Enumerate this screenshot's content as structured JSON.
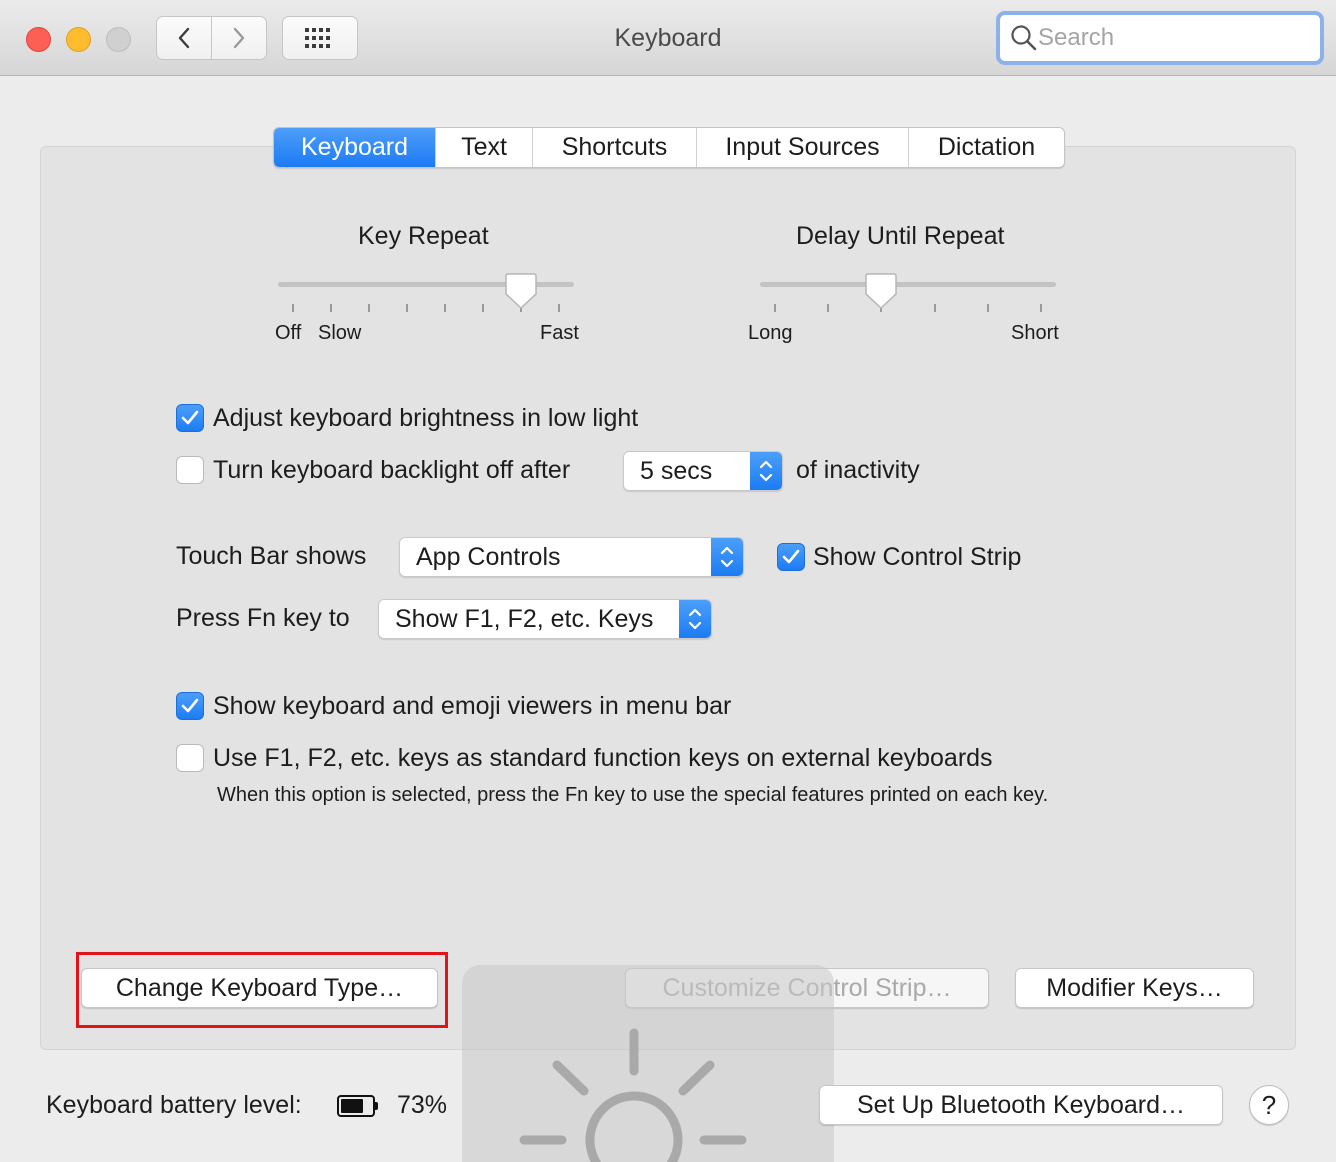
{
  "window": {
    "title": "Keyboard"
  },
  "search": {
    "placeholder": "Search"
  },
  "tabs": [
    {
      "label": "Keyboard",
      "active": true
    },
    {
      "label": "Text",
      "active": false
    },
    {
      "label": "Shortcuts",
      "active": false
    },
    {
      "label": "Input Sources",
      "active": false
    },
    {
      "label": "Dictation",
      "active": false
    }
  ],
  "key_repeat": {
    "title": "Key Repeat",
    "left_labels": [
      "Off",
      "Slow"
    ],
    "right_label": "Fast",
    "value_fraction": 0.82
  },
  "delay_until_repeat": {
    "title": "Delay Until Repeat",
    "left_label": "Long",
    "right_label": "Short",
    "value_fraction": 0.4
  },
  "options": {
    "adjust_brightness": {
      "label": "Adjust keyboard brightness in low light",
      "checked": true
    },
    "backlight_off": {
      "label": "Turn keyboard backlight off after",
      "checked": false,
      "duration": "5 secs",
      "suffix": "of inactivity"
    },
    "touch_bar": {
      "label": "Touch Bar shows",
      "value": "App Controls"
    },
    "show_control_strip": {
      "label": "Show Control Strip",
      "checked": true
    },
    "fn_key": {
      "label": "Press Fn key to",
      "value": "Show F1, F2, etc. Keys"
    },
    "show_viewers": {
      "label": "Show keyboard and emoji viewers in menu bar",
      "checked": true
    },
    "standard_function_keys": {
      "label": "Use F1, F2, etc. keys as standard function keys on external keyboards",
      "checked": false,
      "help": "When this option is selected, press the Fn key to use the special features printed on each key."
    }
  },
  "buttons": {
    "change_type": "Change Keyboard Type…",
    "customize_strip": "Customize Control Strip…",
    "modifier_keys": "Modifier Keys…",
    "bluetooth": "Set Up Bluetooth Keyboard…",
    "help": "?"
  },
  "battery": {
    "label": "Keyboard battery level:",
    "percent": "73%",
    "level": 0.73
  },
  "colors": {
    "accent": "#1d7cf4",
    "highlight": "#e3131b"
  }
}
